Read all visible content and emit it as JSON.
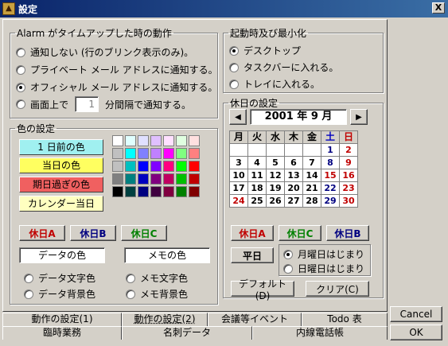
{
  "window": {
    "title": "設定",
    "close_glyph": "X"
  },
  "alarm": {
    "legend": "Alarm がタイムアップした時の動作",
    "options": [
      {
        "label": "通知しない (行のブリンク表示のみ)。",
        "checked": false
      },
      {
        "label": "プライベート メール アドレスに通知する。",
        "checked": false
      },
      {
        "label": "オフィシャル メール アドレスに通知する。",
        "checked": true
      }
    ],
    "screen_option": {
      "prefix": "画面上で",
      "value": "1",
      "suffix": "分間隔で通知する。",
      "checked": false
    }
  },
  "startup": {
    "legend": "起動時及び最小化",
    "options": [
      {
        "label": "デスクトップ",
        "checked": true
      },
      {
        "label": "タスクバーに入れる。",
        "checked": false
      },
      {
        "label": "トレイに入れる。",
        "checked": false
      }
    ]
  },
  "colors": {
    "legend": "色の設定",
    "labels": [
      {
        "text": "1 日前の色",
        "bg": "#a0f0f0"
      },
      {
        "text": "当日の色",
        "bg": "#ffff60"
      },
      {
        "text": "期日過ぎの色",
        "bg": "#f06060"
      },
      {
        "text": "カレンダー当日",
        "bg": "#ffffc0"
      }
    ],
    "palette": [
      "#ffffff",
      "#e0ffff",
      "#e0e0ff",
      "#e0c0ff",
      "#ffe0ff",
      "#e0ffe0",
      "#ffe0e0",
      "#c0c0c0",
      "#00ffff",
      "#8080ff",
      "#c080ff",
      "#ff00ff",
      "#80ff80",
      "#ff8080",
      "#c0c0c0",
      "#00c0c0",
      "#0000ff",
      "#8000ff",
      "#ff0080",
      "#00ff00",
      "#ff0000",
      "#808080",
      "#008080",
      "#0000c0",
      "#800080",
      "#c00060",
      "#00c000",
      "#c00000",
      "#000000",
      "#004040",
      "#000080",
      "#400040",
      "#800040",
      "#008000",
      "#800000"
    ],
    "holiday_buttons": [
      {
        "text": "休日A",
        "color": "#c00000"
      },
      {
        "text": "休日B",
        "color": "#000080"
      },
      {
        "text": "休日C",
        "color": "#008000"
      }
    ],
    "data_color_label": "データの色",
    "memo_color_label": "メモの色",
    "radios_left": [
      {
        "label": "データ文字色",
        "checked": false
      },
      {
        "label": "データ背景色",
        "checked": false
      }
    ],
    "radios_right": [
      {
        "label": "メモ文字色",
        "checked": false
      },
      {
        "label": "メモ背景色",
        "checked": false
      }
    ]
  },
  "holiday": {
    "legend": "休日の設定",
    "prev_glyph": "◀",
    "next_glyph": "▶",
    "month_label": "2001 年 9 月",
    "weekdays": [
      {
        "text": "月",
        "color": "#000000"
      },
      {
        "text": "火",
        "color": "#000000"
      },
      {
        "text": "水",
        "color": "#000000"
      },
      {
        "text": "木",
        "color": "#000000"
      },
      {
        "text": "金",
        "color": "#000000"
      },
      {
        "text": "土",
        "color": "#0000c0"
      },
      {
        "text": "日",
        "color": "#c00000"
      }
    ],
    "weeks": [
      [
        {
          "t": "",
          "c": "#000"
        },
        {
          "t": "",
          "c": "#000"
        },
        {
          "t": "",
          "c": "#000"
        },
        {
          "t": "",
          "c": "#000"
        },
        {
          "t": "",
          "c": "#000"
        },
        {
          "t": "1",
          "c": "#000080"
        },
        {
          "t": "2",
          "c": "#c00000"
        }
      ],
      [
        {
          "t": "3",
          "c": "#000"
        },
        {
          "t": "4",
          "c": "#000"
        },
        {
          "t": "5",
          "c": "#000"
        },
        {
          "t": "6",
          "c": "#000"
        },
        {
          "t": "7",
          "c": "#000"
        },
        {
          "t": "8",
          "c": "#000080"
        },
        {
          "t": "9",
          "c": "#c00000"
        }
      ],
      [
        {
          "t": "10",
          "c": "#000"
        },
        {
          "t": "11",
          "c": "#000"
        },
        {
          "t": "12",
          "c": "#000"
        },
        {
          "t": "13",
          "c": "#000"
        },
        {
          "t": "14",
          "c": "#000"
        },
        {
          "t": "15",
          "c": "#c00000"
        },
        {
          "t": "16",
          "c": "#c00000"
        }
      ],
      [
        {
          "t": "17",
          "c": "#000"
        },
        {
          "t": "18",
          "c": "#000"
        },
        {
          "t": "19",
          "c": "#000"
        },
        {
          "t": "20",
          "c": "#000"
        },
        {
          "t": "21",
          "c": "#000"
        },
        {
          "t": "22",
          "c": "#000080"
        },
        {
          "t": "23",
          "c": "#c00000"
        }
      ],
      [
        {
          "t": "24",
          "c": "#c00000"
        },
        {
          "t": "25",
          "c": "#000"
        },
        {
          "t": "26",
          "c": "#000"
        },
        {
          "t": "27",
          "c": "#000"
        },
        {
          "t": "28",
          "c": "#000"
        },
        {
          "t": "29",
          "c": "#000080"
        },
        {
          "t": "30",
          "c": "#c00000"
        }
      ]
    ],
    "holiday_buttons": [
      {
        "text": "休日A",
        "color": "#c00000"
      },
      {
        "text": "休日C",
        "color": "#008000"
      },
      {
        "text": "休日B",
        "color": "#000080"
      }
    ],
    "weekday_button": "平日",
    "start_options": [
      {
        "label": "月曜日はじまり",
        "checked": true
      },
      {
        "label": "日曜日はじまり",
        "checked": false
      }
    ],
    "default_button": "デフォルト(D)",
    "clear_button": "クリア(C)"
  },
  "tabs": {
    "top_row": [
      "動作の設定(1)",
      "動作の設定(2)",
      "会議等イベント",
      "Todo 表"
    ],
    "bottom_row": [
      "臨時業務",
      "名刺データ",
      "内線電話帳"
    ],
    "active": "動作の設定(2)"
  },
  "buttons": {
    "cancel": "Cancel",
    "ok": "OK"
  }
}
